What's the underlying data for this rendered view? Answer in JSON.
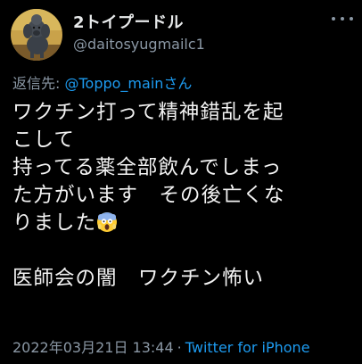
{
  "author": {
    "display_name": "2トイプードル",
    "handle": "@daitosyugmailc1",
    "avatar_icon": "poodle-avatar-icon"
  },
  "more_icon": "more-options-icon",
  "reply": {
    "prefix": "返信先: ",
    "mention": "@Toppo_main",
    "suffix": "さん"
  },
  "body": {
    "line1": "ワクチン打って精神錯乱を起",
    "line2": "こして",
    "line3": "持ってる薬全部飲んでしまっ",
    "line4": "た方がいます　その後亡くな",
    "line5": "りました",
    "emoji": "face-screaming-in-fear-emoji",
    "line7": "医師会の闇　ワクチン怖い"
  },
  "meta": {
    "timestamp": "2022年03月21日 13:44",
    "separator": "·",
    "source": "Twitter for iPhone"
  },
  "colors": {
    "background": "#000000",
    "text": "#e7e9ea",
    "secondary": "#8b98a5",
    "link": "#1d9bf0"
  }
}
